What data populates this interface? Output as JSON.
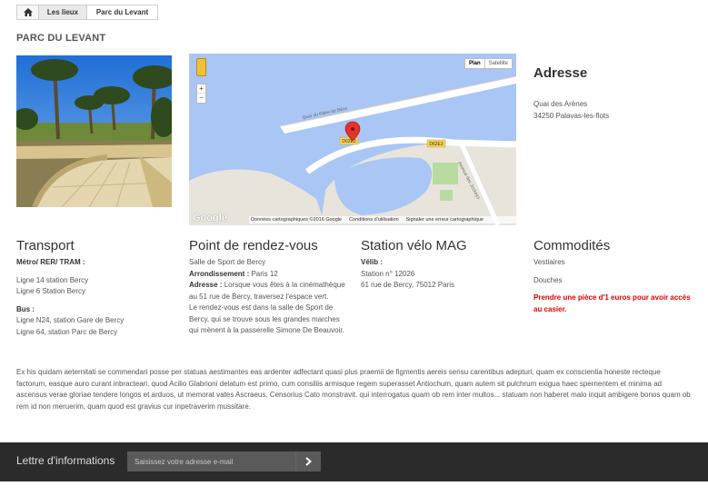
{
  "breadcrumb": {
    "home_icon": "home-icon",
    "items": [
      {
        "label": "Les lieux"
      },
      {
        "label": "Parc du Levant"
      }
    ]
  },
  "page_title": "PARC DU LEVANT",
  "map": {
    "type_buttons": [
      "Plan",
      "Satellite"
    ],
    "zoom_in": "+",
    "zoom_out": "−",
    "road_labels": [
      "D62E3",
      "D62E3",
      "Quai du Pâtre de Béze",
      "Avenue des Jockeys"
    ],
    "logo": "Google",
    "footer": [
      "Données cartographiques ©2016 Google",
      "Conditions d'utilisation",
      "Signaler une erreur cartographique"
    ]
  },
  "adresse": {
    "heading": "Adresse",
    "line1": "Quai des Arènes",
    "line2": "34250 Palavas-les-flots"
  },
  "transport": {
    "heading": "Transport",
    "metro_label": "Métro/ RER/ TRAM :",
    "metro_lines": [
      "Ligne 14 station Bercy",
      "Ligne 6 Station Bercy"
    ],
    "bus_label": "Bus :",
    "bus_lines": [
      "Ligne N24, station Gare de Bercy",
      "Ligne 64, station Parc de Bercy"
    ]
  },
  "rdv": {
    "heading": "Point de rendez-vous",
    "line1": "Salle de Sport de Bercy",
    "arr_label": "Arrondissement :",
    "arr_value": " Paris 12",
    "adresse_label": "Adresse :",
    "adresse_value": " Lorsque vous êtes à la cinémathèque au 51 rue de Bercy, traversez l'espace vert.",
    "description": "Le rendez-vous est dans la salle de Sport de Bercy, qui se trouve sous les grandes marches qui mènent à la passerelle Simone De Beauvoir."
  },
  "velo": {
    "heading": "Station vélo MAG",
    "velib_label": "Vélib :",
    "station": "Station n° 12026",
    "address": "61 rue de Bercy, 75012 Paris"
  },
  "commodites": {
    "heading": "Commodités",
    "items": [
      "Vestiaires",
      "Douches"
    ],
    "note": "Prendre une pièce d'1 euros pour avoir accès au casier."
  },
  "paragraph": "Ex his quidam aeternitati se commendari posse per statuas aestimantes eas ardenter adfectant quasi plus praemii de figmentis aereis sensu carentibus adepturi, quam ex conscientia honeste recteque factorum, easque auro curant inbracteari, quod Acilio Glabrioni delatum est primo, cum consiliis armisque regem superasset Antiochum, quam autem sit pulchrum exigua haec spernentem et minima ad ascensus verae gloriae tendere longos et arduos, ut memorat vates Ascraeus, Censorius Cato monstravit. qui interrogatus quam ob rem inter multos... statuam non haberet malo inquit ambigere bonos quam ob rem id non meruerim, quam quod est gravius cur inpetraverim mussitare.",
  "newsletter": {
    "label": "Lettre d'informations",
    "placeholder": "Saisissez votre adresse e-mail",
    "submit_icon": "chevron-right-icon"
  }
}
